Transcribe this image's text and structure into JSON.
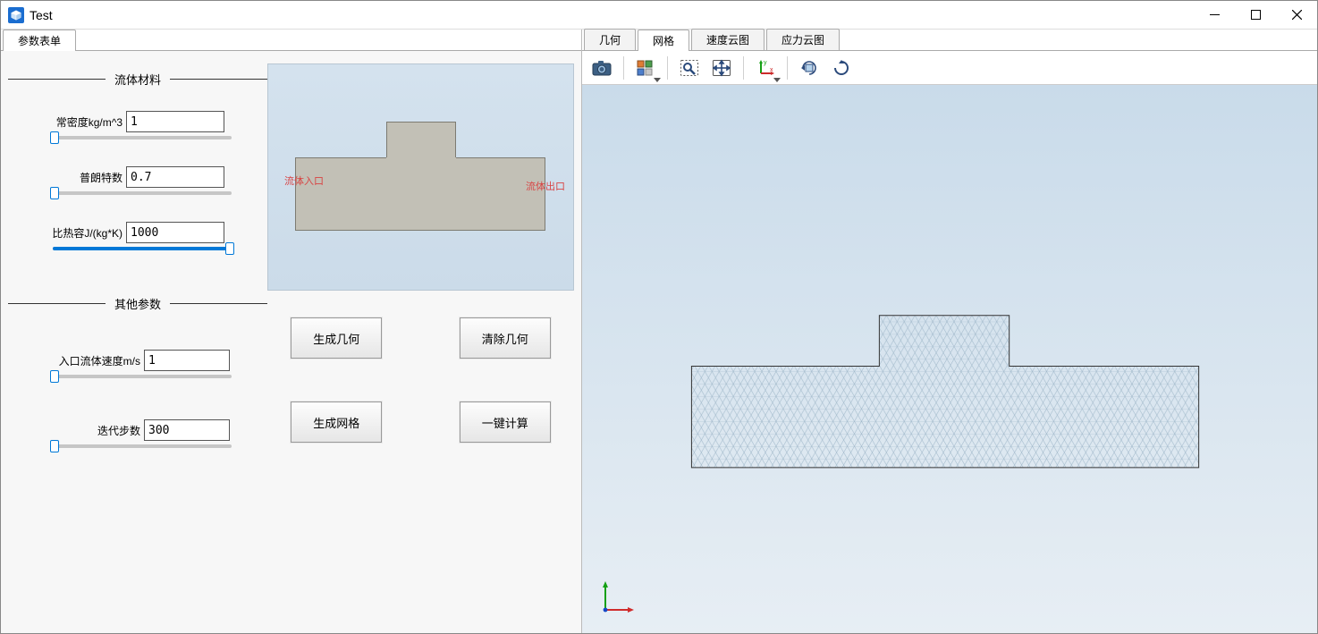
{
  "window": {
    "title": "Test"
  },
  "left_tabs": {
    "param_form": "参数表单"
  },
  "sections": {
    "fluid_material": "流体材料",
    "other_params": "其他参数"
  },
  "params": {
    "density": {
      "label": "常密度kg/m^3",
      "value": "1",
      "fill_pct": 0
    },
    "prandtl": {
      "label": "普朗特数",
      "value": "0.7",
      "fill_pct": 0
    },
    "heat_capacity": {
      "label": "比热容J/(kg*K)",
      "value": "1000",
      "fill_pct": 100
    },
    "inlet_velocity": {
      "label": "入口流体速度m/s",
      "value": "1",
      "fill_pct": 0
    },
    "iterations": {
      "label": "迭代步数",
      "value": "300",
      "fill_pct": 0
    }
  },
  "preview": {
    "inlet_label": "流体入口",
    "outlet_label": "流体出口"
  },
  "buttons": {
    "gen_geom": "生成几何",
    "clear_geom": "清除几何",
    "gen_mesh": "生成网格",
    "calc_all": "一键计算"
  },
  "right_tabs": {
    "geometry": "几何",
    "mesh": "网格",
    "velocity_cloud": "速度云图",
    "stress_cloud": "应力云图"
  },
  "toolbar_icons": {
    "camera": "camera-icon",
    "multiview": "multiview-icon",
    "zoom_box": "zoom-box-icon",
    "pan": "pan-icon",
    "axes": "axes-icon",
    "rotate_cw": "rotate-cw-icon",
    "rotate_ccw": "rotate-ccw-icon"
  }
}
